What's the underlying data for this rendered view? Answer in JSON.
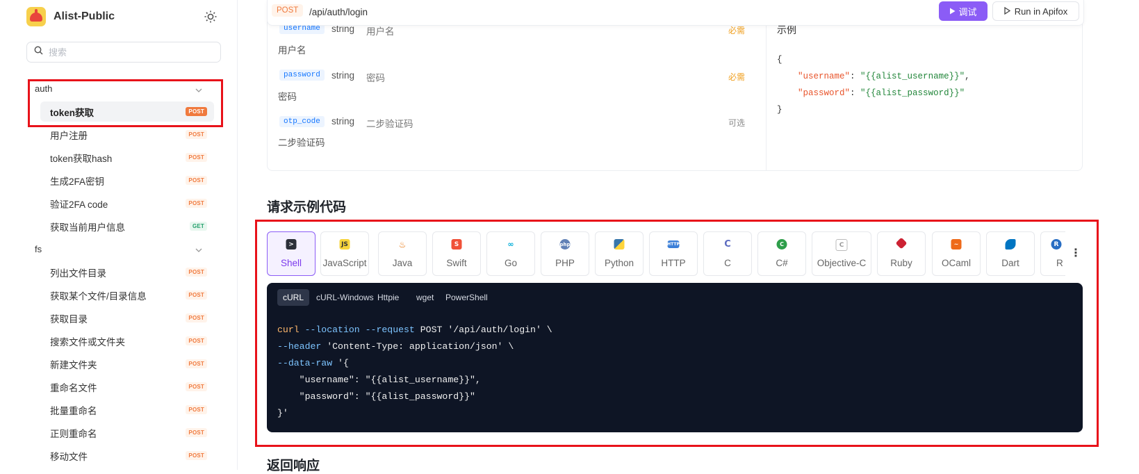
{
  "app": {
    "name": "Alist-Public"
  },
  "search": {
    "placeholder": "搜索"
  },
  "sidebar": {
    "groups": [
      {
        "name": "auth",
        "items": [
          {
            "label": "token获取",
            "method": "POST"
          },
          {
            "label": "用户注册",
            "method": "POST"
          },
          {
            "label": "token获取hash",
            "method": "POST"
          },
          {
            "label": "生成2FA密钥",
            "method": "POST"
          },
          {
            "label": "验证2FA code",
            "method": "POST"
          },
          {
            "label": "获取当前用户信息",
            "method": "GET"
          }
        ]
      },
      {
        "name": "fs",
        "items": [
          {
            "label": "列出文件目录",
            "method": "POST"
          },
          {
            "label": "获取某个文件/目录信息",
            "method": "POST"
          },
          {
            "label": "获取目录",
            "method": "POST"
          },
          {
            "label": "搜索文件或文件夹",
            "method": "POST"
          },
          {
            "label": "新建文件夹",
            "method": "POST"
          },
          {
            "label": "重命名文件",
            "method": "POST"
          },
          {
            "label": "批量重命名",
            "method": "POST"
          },
          {
            "label": "正则重命名",
            "method": "POST"
          },
          {
            "label": "移动文件",
            "method": "POST"
          }
        ]
      }
    ]
  },
  "request": {
    "method": "POST",
    "path": "/api/auth/login",
    "debug_label": "调试",
    "run_label": "Run in Apifox"
  },
  "params": [
    {
      "name": "username",
      "type": "string",
      "title": "用户名",
      "required": "必需",
      "desc": "用户名"
    },
    {
      "name": "password",
      "type": "string",
      "title": "密码",
      "required": "必需",
      "desc": "密码"
    },
    {
      "name": "otp_code",
      "type": "string",
      "title": "二步验证码",
      "required": "可选",
      "desc": "二步验证码"
    }
  ],
  "example": {
    "title": "示例",
    "open": "{",
    "close": "}",
    "fields": [
      {
        "key": "\"username\"",
        "value": "\"{{alist_username}}\"",
        "sep": ",",
        "colon": ": "
      },
      {
        "key": "\"password\"",
        "value": "\"{{alist_password}}\"",
        "sep": "",
        "colon": ": "
      }
    ]
  },
  "code_section": {
    "title": "请求示例代码",
    "languages": [
      "Shell",
      "JavaScript",
      "Java",
      "Swift",
      "Go",
      "PHP",
      "Python",
      "HTTP",
      "C",
      "C#",
      "Objective-C",
      "Ruby",
      "OCaml",
      "Dart",
      "R"
    ],
    "active_language": "Shell",
    "sub_tabs": [
      "cURL",
      "cURL-Windows",
      "Httpie",
      "wget",
      "PowerShell"
    ],
    "active_sub_tab": "cURL",
    "code": {
      "l1_cmd": "curl",
      "l1_opts": " --location --request",
      "l1_rest": " POST '/api/auth/login' \\",
      "l2_opt": "--header",
      "l2_rest": " 'Content-Type: application/json' \\",
      "l3_opt": "--data-raw",
      "l3_rest": " '{",
      "l4": "    \"username\": \"{{alist_username}}\",",
      "l5": "    \"password\": \"{{alist_password}}\"",
      "l6": "}'"
    }
  },
  "response": {
    "title": "返回响应"
  },
  "colors": {
    "accent": "#8b5cf6",
    "post": "#f07a3e",
    "get": "#22a06b",
    "highlight": "#e8121a",
    "code_bg": "#0e1525"
  }
}
